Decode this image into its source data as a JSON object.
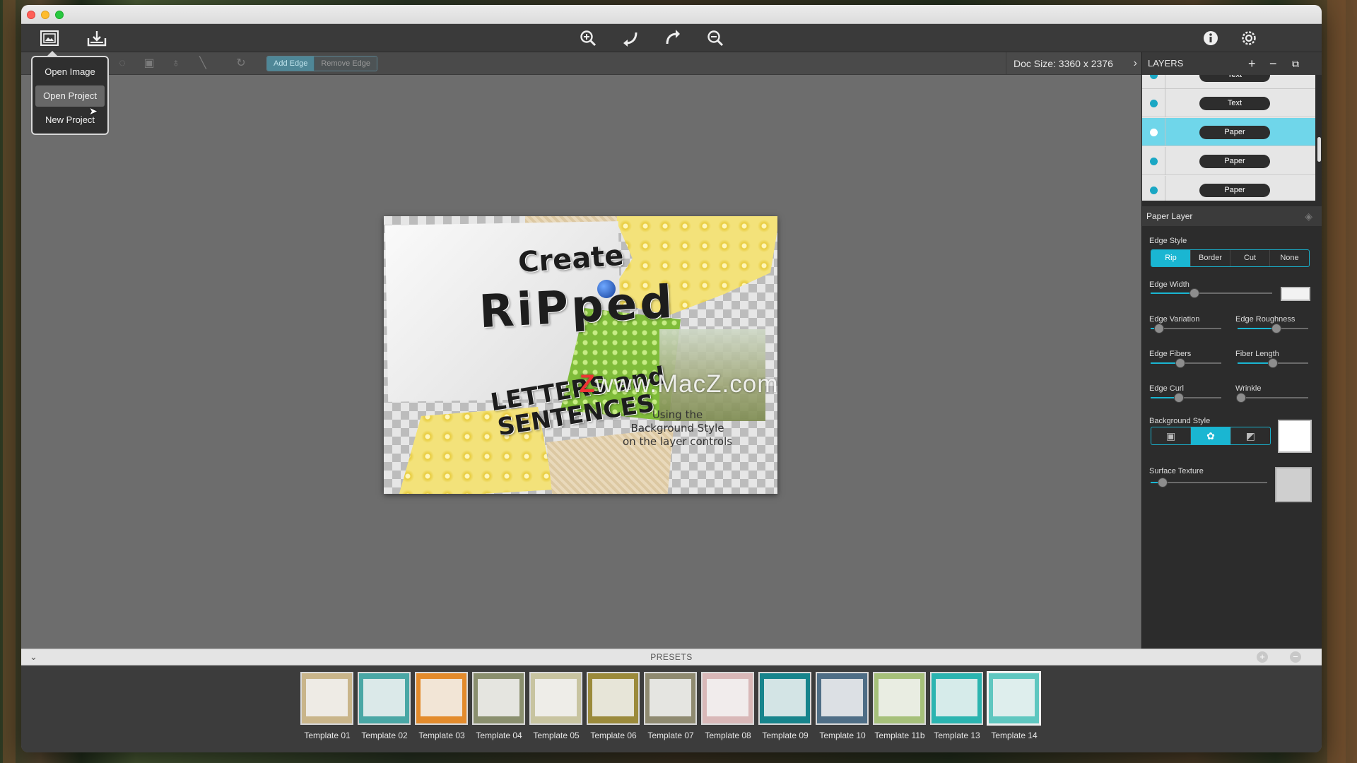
{
  "toolbar": {
    "left_icons": [
      "image-open-icon",
      "export-icon"
    ],
    "center_icons": [
      "zoom-in-icon",
      "undo-icon",
      "redo-icon",
      "zoom-out-icon"
    ],
    "right_icons": [
      "info-icon",
      "settings-icon"
    ]
  },
  "subtoolbar": {
    "add_edge": "Add Edge",
    "remove_edge": "Remove Edge",
    "doc_size": "Doc Size: 3360 x 2376"
  },
  "file_menu": {
    "items": [
      "Open Image",
      "Open Project",
      "New Project"
    ],
    "hovered": "Open Project"
  },
  "artwork": {
    "create": "Create",
    "ripped": "RiPped",
    "letters": "LETTERS and",
    "sentences": "SENTENCES",
    "caption": "Using the\nBackground Style\non the layer controls"
  },
  "watermark": {
    "z": "Z",
    "text": "www.MacZ.com"
  },
  "layers": {
    "title": "LAYERS",
    "items": [
      {
        "name": "Text",
        "selected": false
      },
      {
        "name": "Text",
        "selected": false
      },
      {
        "name": "Paper",
        "selected": true
      },
      {
        "name": "Paper",
        "selected": false
      },
      {
        "name": "Paper",
        "selected": false
      }
    ]
  },
  "paper_layer": {
    "title": "Paper Layer",
    "edge_style_label": "Edge Style",
    "edge_styles": [
      "Rip",
      "Border",
      "Cut",
      "None"
    ],
    "edge_style_selected": "Rip",
    "edge_width_label": "Edge Width",
    "edge_width": 0.36,
    "edge_variation_label": "Edge Variation",
    "edge_variation": 0.12,
    "edge_roughness_label": "Edge Roughness",
    "edge_roughness": 0.55,
    "edge_fibers_label": "Edge Fibers",
    "edge_fibers": 0.42,
    "fiber_length_label": "Fiber Length",
    "fiber_length": 0.5,
    "edge_curl_label": "Edge Curl",
    "edge_curl": 0.4,
    "wrinkle_label": "Wrinkle",
    "wrinkle": 0.05,
    "background_style_label": "Background Style",
    "background_style_selected": 1,
    "surface_texture_label": "Surface Texture",
    "surface_texture": 0.1,
    "accent": "#1ab6d2"
  },
  "presets": {
    "title": "PRESETS",
    "items": [
      "Template 01",
      "Template 02",
      "Template 03",
      "Template 04",
      "Template 05",
      "Template 06",
      "Template 07",
      "Template 08",
      "Template 09",
      "Template 10",
      "Template 11b",
      "Template 13",
      "Template 14"
    ],
    "colors": [
      "#c9b58a",
      "#4aa7a5",
      "#e38b2c",
      "#8a8f6e",
      "#c8c4a0",
      "#9b8a3b",
      "#8f8a70",
      "#d9b8b8",
      "#17848c",
      "#4f6e86",
      "#a6c07a",
      "#2bb4b0",
      "#5fc7c0"
    ],
    "selected": "Template 14"
  }
}
